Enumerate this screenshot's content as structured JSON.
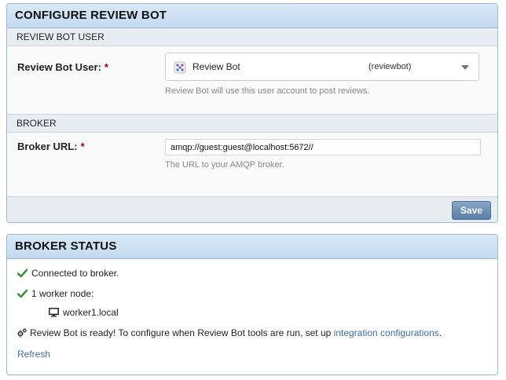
{
  "config_panel": {
    "title": "CONFIGURE REVIEW BOT",
    "review_bot_user_section": {
      "header": "REVIEW BOT USER",
      "label": "Review Bot User:",
      "required_marker": "*",
      "select": {
        "display_name": "Review Bot",
        "username": "(reviewbot)"
      },
      "help_text": "Review Bot will use this user account to post reviews."
    },
    "broker_section": {
      "header": "BROKER",
      "label": "Broker URL:",
      "required_marker": "*",
      "value": "amqp://guest:guest@localhost:5672//",
      "help_text": "The URL to your AMQP broker."
    },
    "save_label": "Save"
  },
  "status_panel": {
    "title": "BROKER STATUS",
    "connected_text": "Connected to broker.",
    "worker_count_text": "1 worker node:",
    "workers": [
      "worker1.local"
    ],
    "ready_text": "Review Bot is ready! To configure when Review Bot tools are run, set up ",
    "integration_link": "integration configurations",
    "ready_suffix": ".",
    "refresh_label": "Refresh"
  },
  "colors": {
    "check": "#2e8b2e",
    "link": "#3a6fa0",
    "required": "#a30000",
    "save_button": "#5b7ea7"
  },
  "icons": [
    "avatar-icon",
    "chevron-down-icon",
    "check-icon",
    "monitor-icon",
    "gears-icon"
  ]
}
